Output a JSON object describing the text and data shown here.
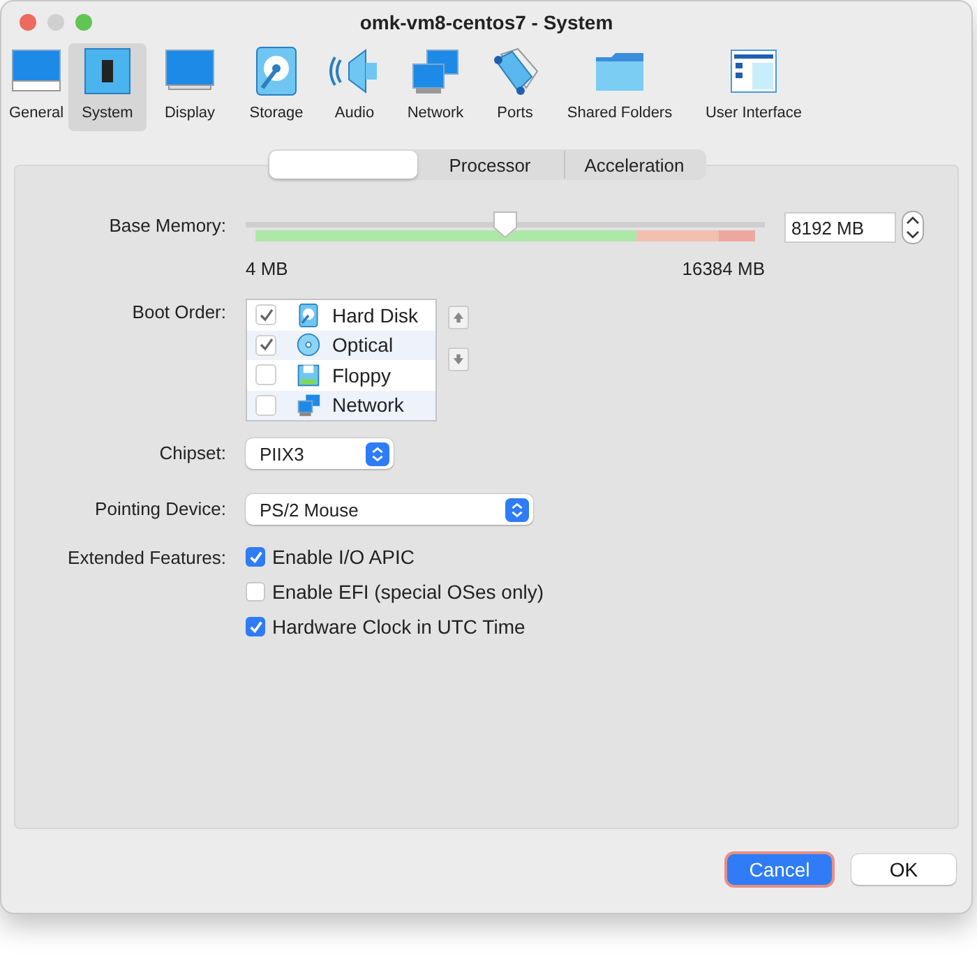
{
  "window": {
    "title": "omk-vm8-centos7 - System"
  },
  "toolbar": [
    {
      "label": "General",
      "kind": "general",
      "selected": false
    },
    {
      "label": "System",
      "kind": "system",
      "selected": true
    },
    {
      "label": "Display",
      "kind": "display",
      "selected": false
    },
    {
      "label": "Storage",
      "kind": "storage",
      "selected": false
    },
    {
      "label": "Audio",
      "kind": "audio",
      "selected": false
    },
    {
      "label": "Network",
      "kind": "network",
      "selected": false
    },
    {
      "label": "Ports",
      "kind": "ports",
      "selected": false
    },
    {
      "label": "Shared Folders",
      "kind": "folder",
      "selected": false
    },
    {
      "label": "User Interface",
      "kind": "ui",
      "selected": false
    }
  ],
  "tabs": [
    {
      "selected": true
    },
    {
      "label": "Processor",
      "selected": false
    },
    {
      "label": "Acceleration",
      "selected": false
    }
  ],
  "base_memory": {
    "label": "Base Memory:",
    "level": 0.5,
    "value": "8192 MB",
    "min_label": "4 MB",
    "max_label": "16384 MB"
  },
  "boot_order": {
    "label": "Boot Order:",
    "items": [
      {
        "label": "Hard Disk",
        "kind": "disk",
        "checked": true
      },
      {
        "label": "Optical",
        "kind": "optical",
        "checked": true
      },
      {
        "label": "Floppy",
        "kind": "floppy",
        "checked": false
      },
      {
        "label": "Network",
        "kind": "network",
        "checked": false
      }
    ]
  },
  "chipset": {
    "label": "Chipset:",
    "value": "PIIX3"
  },
  "pointing_device": {
    "label": "Pointing Device:",
    "value": "PS/2 Mouse"
  },
  "extended_features": {
    "label": "Extended Features:",
    "options": [
      {
        "label": "Enable I/O APIC",
        "checked": true
      },
      {
        "label": "Enable EFI (special OSes only)",
        "checked": false
      },
      {
        "label": "Hardware Clock in UTC Time",
        "checked": true
      }
    ]
  },
  "buttons": [
    {
      "label": "Cancel",
      "kind": "primary"
    },
    {
      "label": "OK",
      "kind": "default"
    }
  ]
}
